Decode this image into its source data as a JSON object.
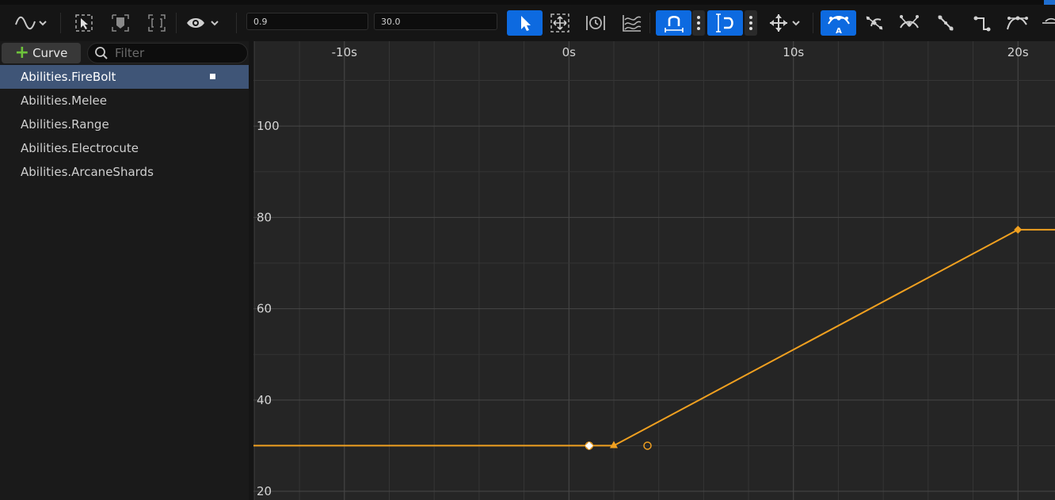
{
  "toolbar": {
    "min_value": "0.9",
    "max_value": "30.0",
    "buttons": [
      {
        "name": "curve-display-icon",
        "active": false
      },
      {
        "name": "select-tool-icon",
        "active": false
      },
      {
        "name": "frame-selection-icon",
        "active": false
      },
      {
        "name": "frame-all-icon",
        "active": false
      },
      {
        "name": "visibility-icon",
        "active": false
      },
      {
        "name": "pointer-icon",
        "active": true
      },
      {
        "name": "transform-icon",
        "active": false
      },
      {
        "name": "retime-icon",
        "active": false
      },
      {
        "name": "multi-scale-icon",
        "active": false
      },
      {
        "name": "time-snap-icon",
        "active": true
      },
      {
        "name": "value-snap-icon",
        "active": true
      },
      {
        "name": "axis-snap-icon",
        "active": false
      },
      {
        "name": "auto-tangent-icon",
        "active": true
      },
      {
        "name": "user-tangent-icon",
        "active": false
      },
      {
        "name": "break-tangent-icon",
        "active": false
      },
      {
        "name": "linear-tangent-icon",
        "active": false
      },
      {
        "name": "constant-tangent-icon",
        "active": false
      },
      {
        "name": "weighted-tangent-icon",
        "active": false
      }
    ],
    "accent_color": "#0d6ae0"
  },
  "left_panel": {
    "add_curve_label": "Curve",
    "filter_placeholder": "Filter",
    "curves": [
      {
        "label": "Abilities.FireBolt",
        "selected": true
      },
      {
        "label": "Abilities.Melee",
        "selected": false
      },
      {
        "label": "Abilities.Range",
        "selected": false
      },
      {
        "label": "Abilities.Electrocute",
        "selected": false
      },
      {
        "label": "Abilities.ArcaneShards",
        "selected": false
      }
    ]
  },
  "chart_data": {
    "type": "line",
    "title": "",
    "xlabel": "",
    "ylabel": "",
    "x_ticks": [
      "-10s",
      "0s",
      "10s",
      "20s"
    ],
    "x_tick_values": [
      -10,
      0,
      10,
      20
    ],
    "y_ticks": [
      "100",
      "80",
      "60",
      "40",
      "20"
    ],
    "y_tick_values": [
      100,
      80,
      60,
      40,
      20
    ],
    "xlim": [
      -14.05,
      21.65
    ],
    "ylim": [
      18.1,
      118.6
    ],
    "series": [
      {
        "color": "#f0a020",
        "keys": [
          {
            "x": 2.0,
            "y": 30.0,
            "shape": "triangle",
            "tangent_in_x": 0.9,
            "tangent_out_x": 3.5
          },
          {
            "x": 20.0,
            "y": 77.3,
            "shape": "diamond"
          }
        ],
        "points": [
          [
            -14.05,
            30.0
          ],
          [
            2.0,
            30.0
          ],
          [
            20.0,
            77.3
          ],
          [
            21.65,
            77.3
          ]
        ]
      }
    ],
    "marker": {
      "x": 0.9,
      "y": 30.0,
      "color": "#ffffff"
    },
    "grid": true
  }
}
